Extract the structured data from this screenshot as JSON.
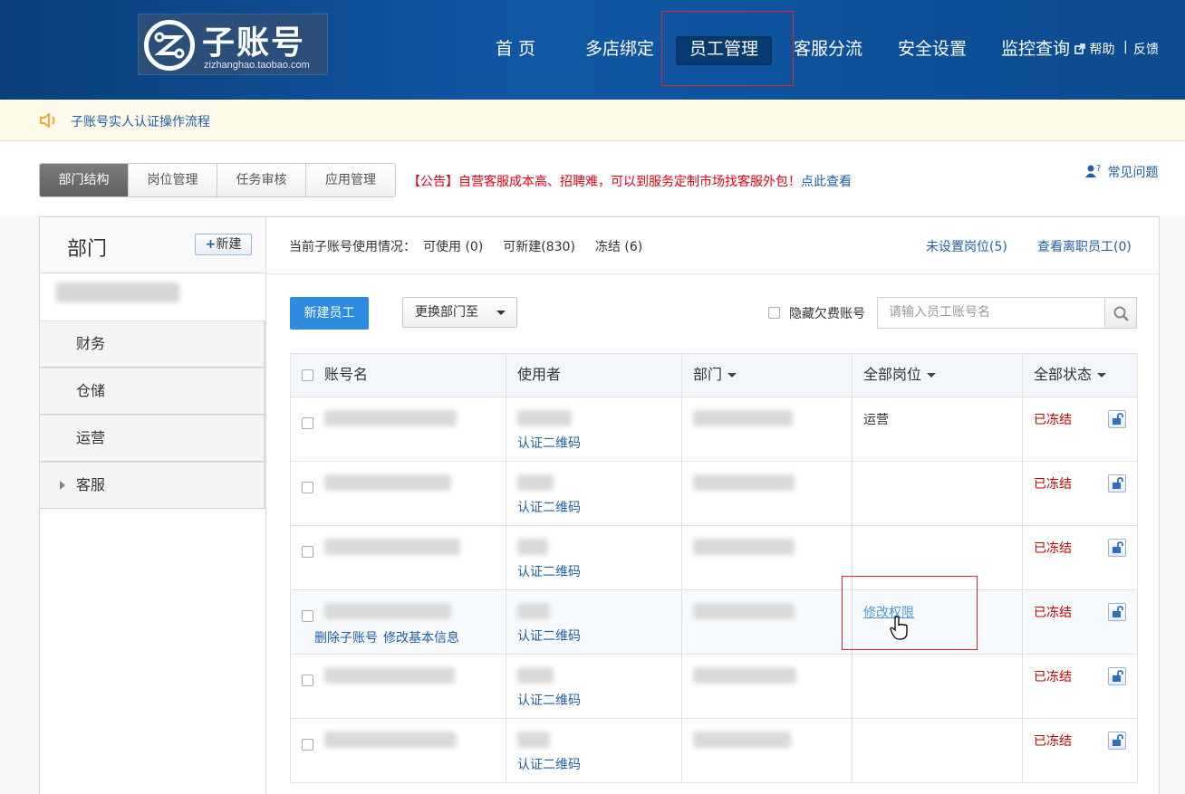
{
  "header": {
    "logo_title": "子账号",
    "logo_sub": "zizhanghao.taobao.com",
    "nav": [
      "首 页",
      "多店绑定",
      "员工管理",
      "客服分流",
      "安全设置",
      "监控查询"
    ],
    "active_nav": "员工管理",
    "help": "帮助",
    "feedback": "反馈",
    "separator": "|"
  },
  "notice": {
    "text": "子账号实人认证操作流程"
  },
  "tabs": [
    "部门结构",
    "岗位管理",
    "任务审核",
    "应用管理"
  ],
  "announcement": {
    "text": "【公告】自营客服成本高、招聘难，可以到服务定制市场找客服外包！",
    "link": "点此查看"
  },
  "faq": "常见问题",
  "sidebar": {
    "title": "部门",
    "new_button": "新建",
    "items": [
      "财务",
      "仓储",
      "运营",
      "客服"
    ]
  },
  "summary": {
    "label": "当前子账号使用情况：",
    "available": "可使用 (0)",
    "creatable": "可新建(830)",
    "frozen": "冻结 (6)"
  },
  "top_links": {
    "unset_post": "未设置岗位(5)",
    "resigned": "查看离职员工(0)"
  },
  "toolbar": {
    "new_employee": "新建员工",
    "move_dept": "更换部门至",
    "hide_overdue": "隐藏欠费账号",
    "search_placeholder": "请输入员工账号名"
  },
  "table": {
    "headers": [
      "账号名",
      "使用者",
      "部门",
      "全部岗位",
      "全部状态"
    ],
    "qr_label": "认证二维码",
    "status_label": "已冻结",
    "delete_label": "删除子账号",
    "edit_label": "修改基本信息",
    "perm_label": "修改权限",
    "rows": [
      {
        "post": "运营",
        "status": "已冻结"
      },
      {
        "post": "",
        "status": "已冻结"
      },
      {
        "post": "",
        "status": "已冻结"
      },
      {
        "post": "",
        "status": "已冻结"
      },
      {
        "post": "",
        "status": "已冻结"
      },
      {
        "post": "",
        "status": "已冻结"
      }
    ]
  },
  "colors": {
    "header_bg": "#1058a6",
    "primary": "#2e8ce0",
    "frozen": "#c40000",
    "link": "#1f5fa6",
    "highlight": "#e0262a"
  }
}
